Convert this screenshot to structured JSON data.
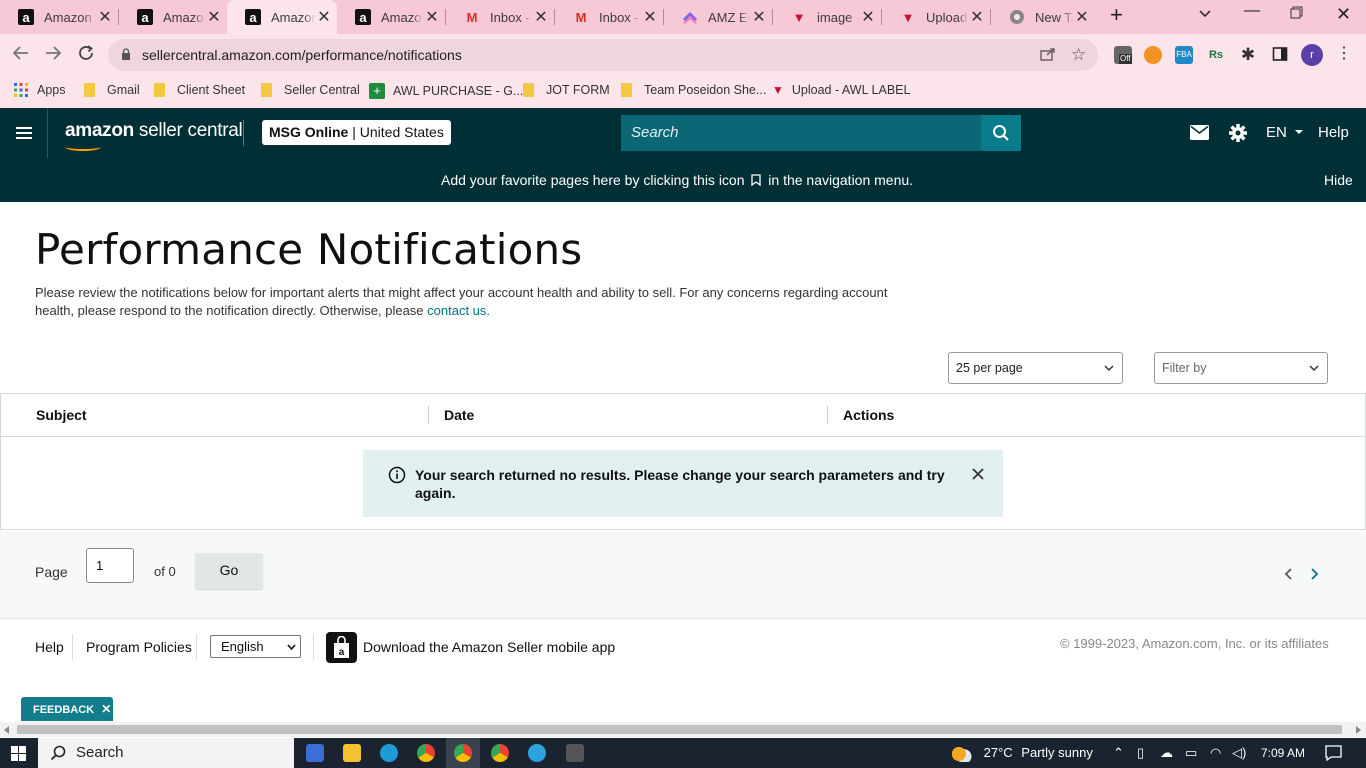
{
  "browser": {
    "tabs": [
      {
        "title": "Amazon",
        "favicon": "amazon-icon"
      },
      {
        "title": "Amazon",
        "favicon": "amazon-icon"
      },
      {
        "title": "Amazon",
        "favicon": "amazon-icon"
      },
      {
        "title": "Amazon",
        "favicon": "amazon-icon"
      },
      {
        "title": "Inbox - a",
        "favicon": "gmail-icon"
      },
      {
        "title": "Inbox - r",
        "favicon": "gmail-icon"
      },
      {
        "title": "AMZ EC",
        "favicon": "clickup-icon"
      },
      {
        "title": "image -",
        "favicon": "vercel-red-icon"
      },
      {
        "title": "Upload",
        "favicon": "vercel-red-icon"
      },
      {
        "title": "New Tab",
        "favicon": "chrome-icon"
      }
    ],
    "active_tab_index": 2,
    "url": "sellercentral.amazon.com/performance/notifications",
    "bookmarks": [
      {
        "label": "Apps",
        "icon": "apps-grid-icon"
      },
      {
        "label": "Gmail",
        "icon": "folder-icon"
      },
      {
        "label": "Client Sheet",
        "icon": "folder-icon"
      },
      {
        "label": "Seller Central",
        "icon": "folder-icon"
      },
      {
        "label": "AWL PURCHASE - G...",
        "icon": "sheets-icon"
      },
      {
        "label": "JOT FORM",
        "icon": "folder-icon"
      },
      {
        "label": "Team Poseidon She...",
        "icon": "folder-icon"
      },
      {
        "label": "Upload - AWL LABEL",
        "icon": "vercel-red-icon"
      }
    ],
    "profile_initial": "r",
    "extension_badge": "Off",
    "extension_labels": {
      "fba": "FBA",
      "rs": "Rs"
    }
  },
  "header": {
    "logo_brand": "amazon",
    "logo_suffix": " seller central",
    "store_name": "MSG Online",
    "marketplace": "United States",
    "search_placeholder": "Search",
    "language": "EN",
    "help": "Help"
  },
  "favorites_banner": {
    "text_before": "Add your favorite pages here by clicking this icon",
    "text_after": "in the navigation menu.",
    "hide": "Hide"
  },
  "page": {
    "title": "Performance Notifications",
    "intro": "Please review the notifications below for important alerts that might affect your account health and ability to sell. For any concerns regarding account health, please respond to the notification directly. Otherwise, please ",
    "contact_link": "contact us.",
    "per_page": "25 per page",
    "filter_placeholder": "Filter by",
    "columns": [
      "Subject",
      "Date",
      "Actions"
    ],
    "empty_message": "Your search returned no results. Please change your search parameters and try again."
  },
  "pager": {
    "label": "Page",
    "current": "1",
    "of_text": "of 0",
    "go": "Go"
  },
  "footer": {
    "help": "Help",
    "policies": "Program Policies",
    "language": "English",
    "app_text": "Download the Amazon Seller mobile app",
    "copyright": "© 1999-2023, Amazon.com, Inc. or its affiliates",
    "feedback": "FEEDBACK"
  },
  "taskbar": {
    "search": "Search",
    "weather_temp": "27°C",
    "weather_text": "Partly sunny",
    "time": "7:09 AM"
  },
  "colors": {
    "header_bg": "#002f36",
    "search_bg": "#0a6876",
    "link": "#007185",
    "alert_bg": "#e3f0f1",
    "tab_strip": "#f7c8d5"
  }
}
